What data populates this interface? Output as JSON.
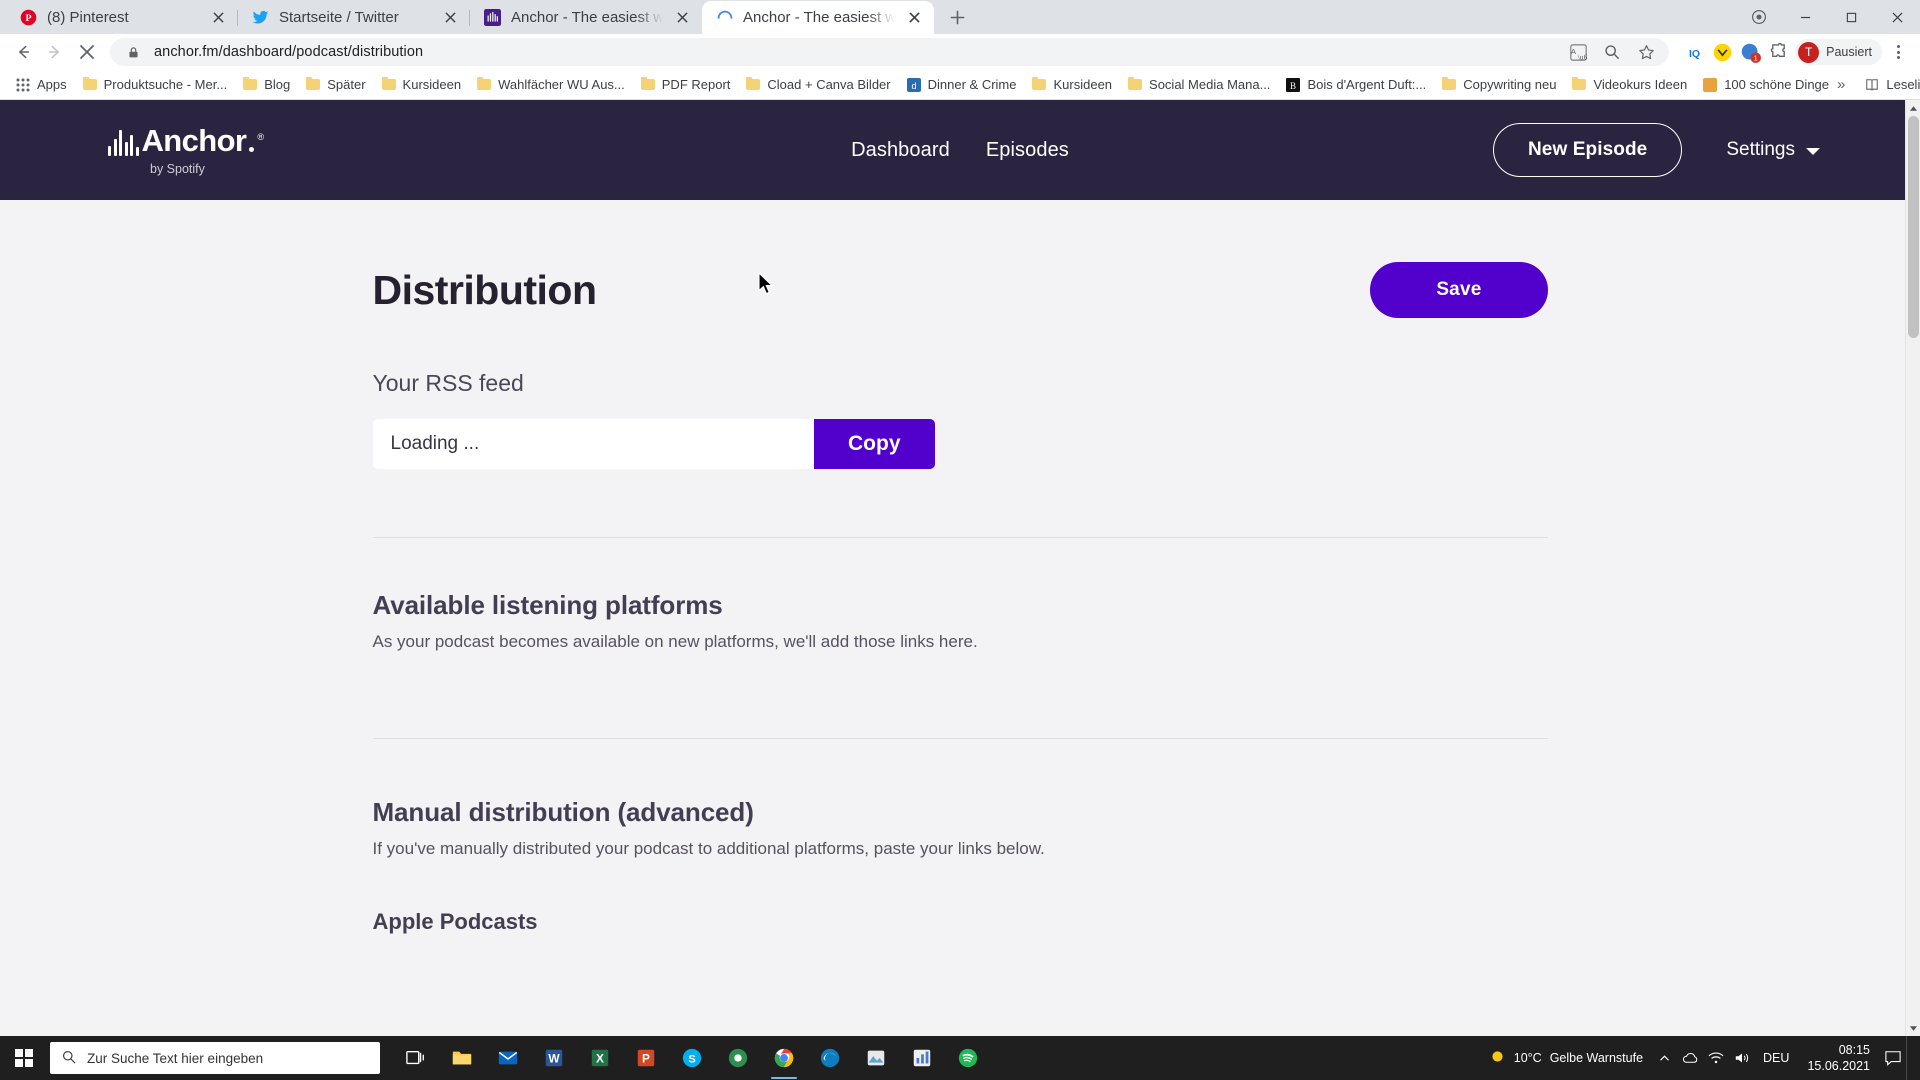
{
  "browser": {
    "tabs": [
      {
        "title": "(8) Pinterest",
        "favicon": "pinterest-icon",
        "active": false
      },
      {
        "title": "Startseite / Twitter",
        "favicon": "twitter-icon",
        "active": false
      },
      {
        "title": "Anchor - The easiest way to mak",
        "favicon": "anchor-icon",
        "active": false
      },
      {
        "title": "Anchor - The easiest way to mak",
        "favicon": "loading-spinner-icon",
        "active": true
      }
    ],
    "new_tab_label": "+",
    "window_controls": {
      "minimize": "–",
      "maximize": "□",
      "close": "✕"
    },
    "nav": {
      "back": "←",
      "forward": "→",
      "stop": "✕"
    },
    "omnibox": {
      "url": "anchor.fm/dashboard/podcast/distribution",
      "lock_icon": "lock-icon",
      "translate_icon": "translate-icon",
      "zoom_icon": "search-zoom-icon",
      "bookmark_icon": "star-icon"
    },
    "extensions": [
      {
        "name": "iq-extension",
        "label": "IQ"
      },
      {
        "name": "yellow-extension",
        "label": "Y"
      },
      {
        "name": "red-badge-extension",
        "label": "1"
      },
      {
        "name": "puzzle-extension",
        "label": "puzzle-icon"
      }
    ],
    "profile": {
      "initial": "T",
      "label": "Pausiert"
    },
    "menu": "chrome-menu-icon",
    "bookmarks": [
      {
        "label": "Apps",
        "icon": "apps-grid-icon"
      },
      {
        "label": "Produktsuche - Mer...",
        "icon": "folder-icon"
      },
      {
        "label": "Blog",
        "icon": "folder-icon"
      },
      {
        "label": "Später",
        "icon": "folder-icon"
      },
      {
        "label": "Kursideen",
        "icon": "folder-icon"
      },
      {
        "label": "Wahlfächer WU Aus...",
        "icon": "folder-icon"
      },
      {
        "label": "PDF Report",
        "icon": "folder-icon"
      },
      {
        "label": "Cload + Canva Bilder",
        "icon": "folder-icon"
      },
      {
        "label": "Dinner & Crime",
        "icon": "site-icon"
      },
      {
        "label": "Kursideen",
        "icon": "folder-icon"
      },
      {
        "label": "Social Media Mana...",
        "icon": "folder-icon"
      },
      {
        "label": "Bois d'Argent Duft:...",
        "icon": "site-icon"
      },
      {
        "label": "Copywriting neu",
        "icon": "folder-icon"
      },
      {
        "label": "Videokurs Ideen",
        "icon": "folder-icon"
      },
      {
        "label": "100 schöne Dinge",
        "icon": "site-icon"
      }
    ],
    "bookmarks_overflow": "»",
    "reading_list": "Leseliste"
  },
  "site": {
    "logo": {
      "word": "Anchor",
      "registered": "®",
      "sub": "by Spotify"
    },
    "nav_links": [
      {
        "label": "Dashboard"
      },
      {
        "label": "Episodes"
      }
    ],
    "new_episode_label": "New Episode",
    "settings_label": "Settings"
  },
  "page": {
    "title": "Distribution",
    "save_label": "Save",
    "rss": {
      "label": "Your RSS feed",
      "value": "Loading ...",
      "copy_label": "Copy"
    },
    "platforms": {
      "title": "Available listening platforms",
      "description": "As your podcast becomes available on new platforms, we'll add those links here."
    },
    "manual": {
      "title": "Manual distribution (advanced)",
      "description": "If you've manually distributed your podcast to additional platforms, paste your links below.",
      "first_platform": "Apple Podcasts"
    }
  },
  "taskbar": {
    "search_placeholder": "Zur Suche Text hier eingeben",
    "apps": [
      {
        "name": "task-view",
        "label": "task-view-icon"
      },
      {
        "name": "file-explorer",
        "label": "folder-icon"
      },
      {
        "name": "mail",
        "label": "mail-icon"
      },
      {
        "name": "word",
        "label": "W"
      },
      {
        "name": "excel",
        "label": "X"
      },
      {
        "name": "powerpoint",
        "label": "P"
      },
      {
        "name": "skype",
        "label": "skype-icon"
      },
      {
        "name": "camtasia",
        "label": "camtasia-icon"
      },
      {
        "name": "chrome",
        "label": "chrome-icon"
      },
      {
        "name": "edge",
        "label": "edge-icon"
      },
      {
        "name": "photos",
        "label": "photos-icon"
      },
      {
        "name": "charts-app",
        "label": "charts-icon"
      },
      {
        "name": "spotify",
        "label": "spotify-icon"
      }
    ],
    "weather": {
      "temp": "10°C",
      "desc": "Gelbe Warnstufe"
    },
    "language": "DEU",
    "time": "08:15",
    "date": "15.06.2021",
    "tray_expand": "⌃"
  },
  "colors": {
    "brand_purple": "#5200cc",
    "nav_dark": "#2b2440",
    "page_bg": "#f3f2f5"
  }
}
